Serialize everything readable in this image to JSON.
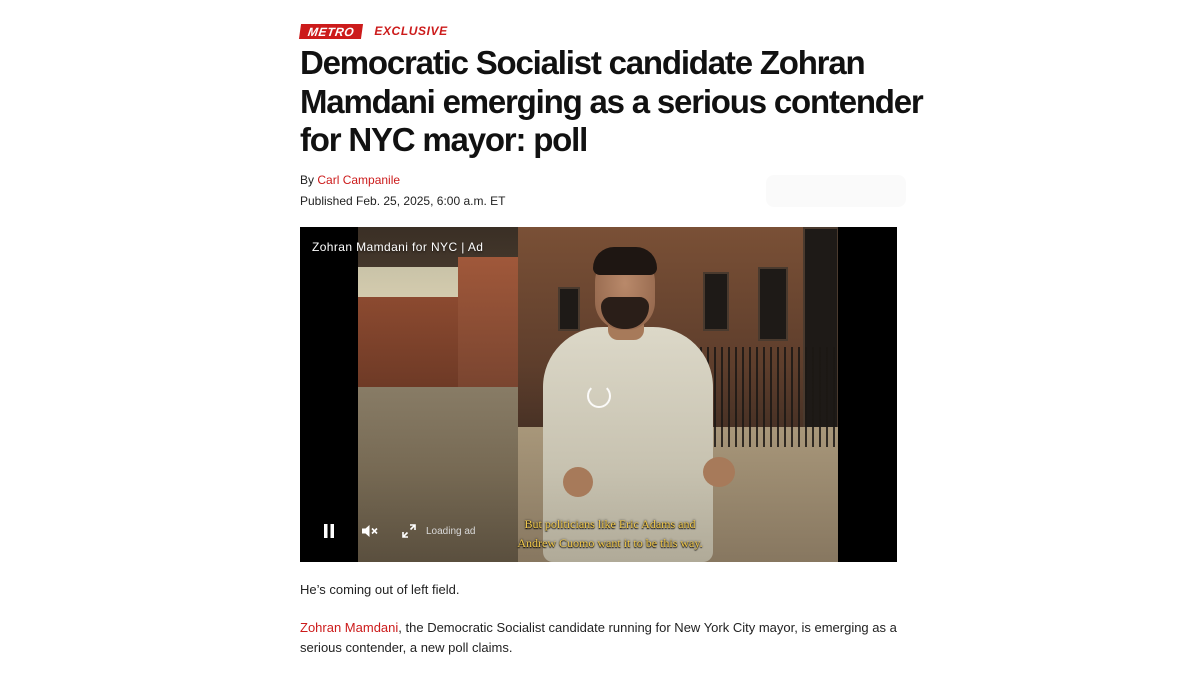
{
  "kicker": {
    "section": "METRO",
    "tag": "EXCLUSIVE"
  },
  "headline": "Democratic Socialist candidate Zohran Mamdani emerging as a serious contender for NYC mayor: poll",
  "byline": {
    "prefix": "By",
    "author": "Carl Campanile"
  },
  "published": "Published Feb. 25, 2025, 6:00 a.m. ET",
  "video": {
    "title": "Zohran Mamdani for NYC | Ad",
    "status_label": "Loading ad",
    "subtitle_line1": "But politicians like Eric Adams and",
    "subtitle_line2": "Andrew Cuomo want it to be this way.",
    "controls": {
      "pause_icon": "pause-icon",
      "mute_icon": "volume-muted-icon",
      "fullscreen_icon": "expand-icon"
    }
  },
  "body": {
    "para1": "He’s coming out of left field.",
    "para2_link": "Zohran Mamdani",
    "para2_rest": ", the Democratic Socialist candidate running for New York City mayor, is emerging as a serious contender, a new poll claims."
  },
  "colors": {
    "accent": "#cc1b1b",
    "subtitle": "#f2c94c"
  }
}
